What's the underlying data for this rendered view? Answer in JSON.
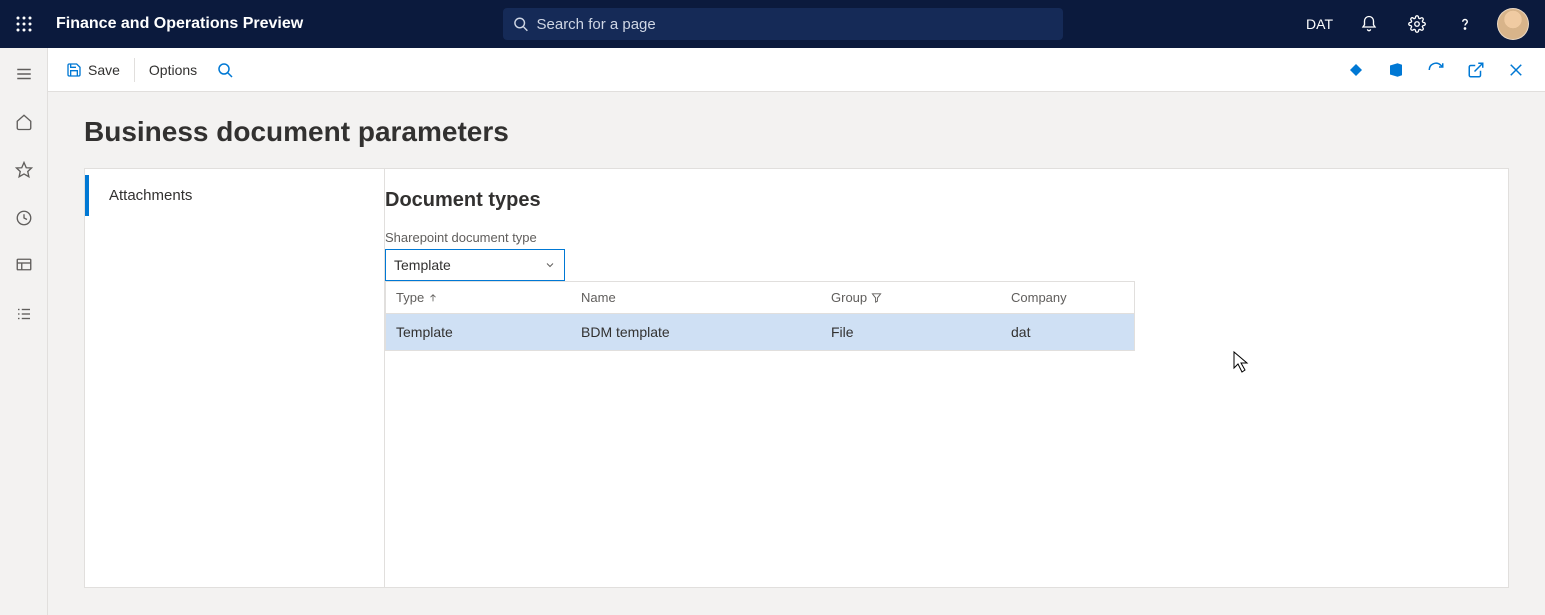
{
  "topbar": {
    "app_title": "Finance and Operations Preview",
    "search_placeholder": "Search for a page",
    "company": "DAT"
  },
  "actionbar": {
    "save_label": "Save",
    "options_label": "Options"
  },
  "page": {
    "title": "Business document parameters"
  },
  "tabs": {
    "attachments": "Attachments"
  },
  "section": {
    "title": "Document types",
    "field_label": "Sharepoint document type",
    "dropdown_value": "Template"
  },
  "grid": {
    "headers": {
      "type": "Type",
      "name": "Name",
      "group": "Group",
      "company": "Company"
    },
    "rows": [
      {
        "type": "Template",
        "name": "BDM template",
        "group": "File",
        "company": "dat"
      }
    ]
  }
}
